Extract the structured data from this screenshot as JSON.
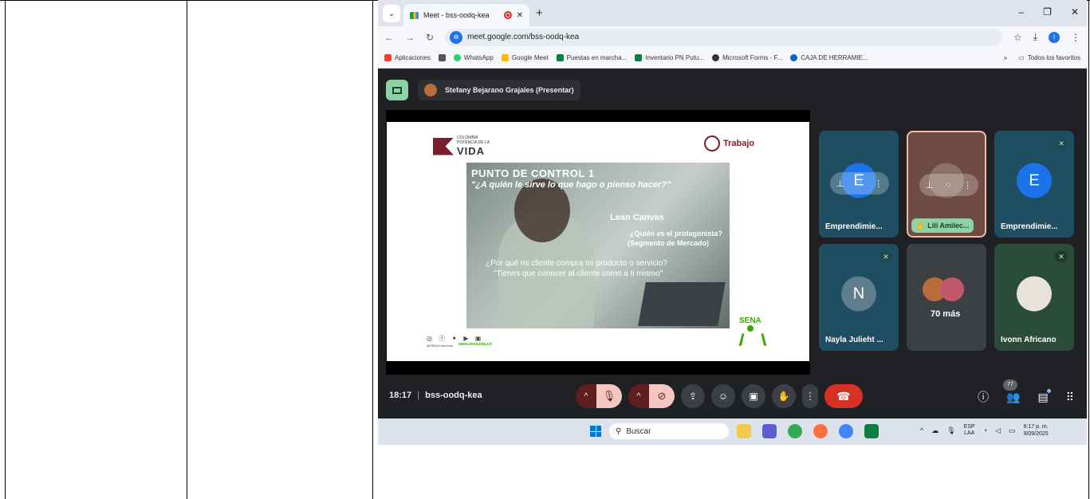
{
  "browser": {
    "tab_title": "Meet - bss-oodq-kea",
    "url": "meet.google.com/bss-oodq-kea",
    "window_controls": [
      "–",
      "❐",
      "✕"
    ]
  },
  "bookmarks": {
    "apps_label": "Aplicaciones",
    "items": [
      "WhatsApp",
      "Google Meet",
      "Puestas en marcha...",
      "Inventario PN Putu...",
      "Microsoft Forms - F...",
      "CAJA DE HERRAMIE..."
    ],
    "more": "»",
    "all_label": "Todos los favoritos"
  },
  "meet": {
    "presenter": "Stefany Bejarano Grajales (Presentar)",
    "time": "18:17",
    "separator": "|",
    "code": "bss-oodq-kea",
    "people_count": "77"
  },
  "slide": {
    "logo_small": "COLOMBIA",
    "logo_tiny": "POTENCIA DE LA",
    "logo_main": "VIDA",
    "ministry": "Trabajo",
    "title": "PUNTO DE CONTROL  1",
    "subtitle": "\"¿A quién le sirve lo que hago o pienso hacer?\"",
    "heading": "Lean Canvas",
    "q1": "¿Quién es el protagonista?",
    "q2": "(Segmento de Mercado)",
    "q3": "¿Por qué mi cliente compra mi producto o servicio?",
    "q4": "\"Tienes que conocer al cliente como a ti mismo\"",
    "social_handle": "@SENAComunica",
    "website": "www.sena.edu.co",
    "sena": "SENA"
  },
  "tiles": [
    {
      "name": "Emprendimie...",
      "initial": "E"
    },
    {
      "name": "Lili Amilec..."
    },
    {
      "name": "Emprendimie...",
      "initial": "E"
    },
    {
      "name": "Nayla Julieht ...",
      "initial": "N"
    },
    {
      "name": "70 más"
    },
    {
      "name": "Ivonn Africano"
    }
  ],
  "taskbar": {
    "search_placeholder": "Buscar",
    "lang1": "ESP",
    "lang2": "LAA",
    "time": "6:17 p. m.",
    "date": "9/09/2025"
  },
  "colors": {
    "meet_bg": "#202124",
    "tile_teal": "#1f4e63",
    "tile_green": "#2c4c3b",
    "hangup": "#d93025",
    "sena_green": "#39a900"
  }
}
